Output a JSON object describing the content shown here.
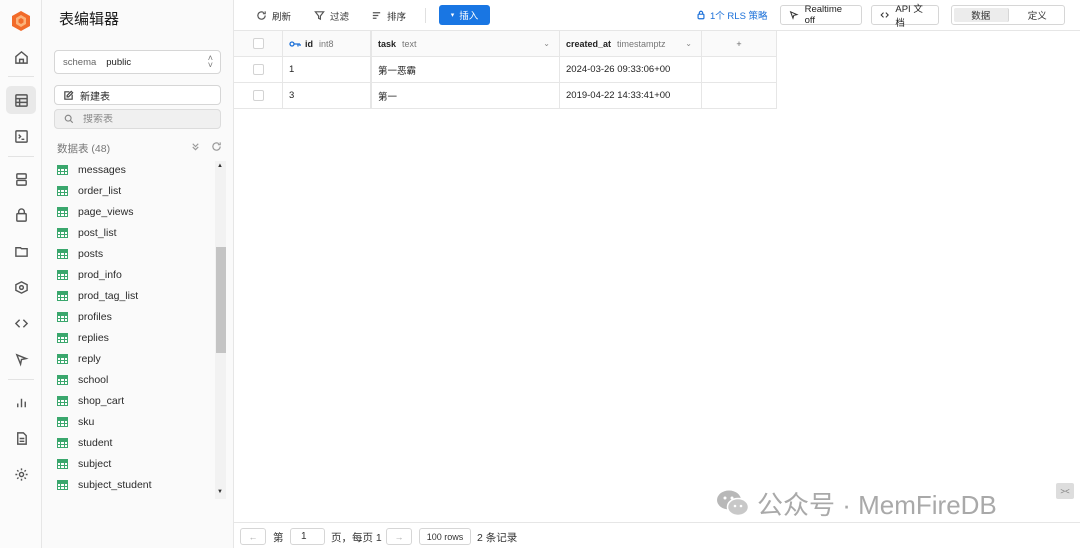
{
  "sidebar": {
    "title": "表编辑器",
    "schema_label": "schema",
    "schema_value": "public",
    "new_table": "新建表",
    "search_placeholder": "搜索表",
    "tables_header": "数据表 (48)",
    "tables": [
      "messages",
      "order_list",
      "page_views",
      "post_list",
      "posts",
      "prod_info",
      "prod_tag_list",
      "profiles",
      "replies",
      "reply",
      "school",
      "shop_cart",
      "sku",
      "student",
      "subject",
      "subject_student"
    ]
  },
  "toolbar": {
    "refresh": "刷新",
    "filter": "过滤",
    "sort": "排序",
    "insert": "插入",
    "rls": "1个 RLS 策略",
    "realtime": "Realtime off",
    "api_docs": "API 文档",
    "view_data": "数据",
    "view_definition": "定义"
  },
  "grid": {
    "columns": [
      {
        "name": "id",
        "type": "int8"
      },
      {
        "name": "task",
        "type": "text"
      },
      {
        "name": "created_at",
        "type": "timestamptz"
      }
    ],
    "add_column": "+",
    "rows": [
      {
        "id": "1",
        "task": "第一恶霸",
        "created_at": "2024-03-26 09:33:06+00"
      },
      {
        "id": "3",
        "task": "第一",
        "created_at": "2019-04-22 14:33:41+00"
      }
    ]
  },
  "footer": {
    "page_label": "第",
    "page_value": "1",
    "page_suffix": "页，每页 1",
    "rows_per_page": "100 rows",
    "record_count": "2 条记录",
    "prev_arrow": "←",
    "next_arrow": "→"
  },
  "watermark": {
    "text": "公众号 · MemFireDB"
  },
  "colors": {
    "accent": "#1976e3",
    "table_icon": "#3aa76d",
    "logo": "#f26b2a"
  }
}
